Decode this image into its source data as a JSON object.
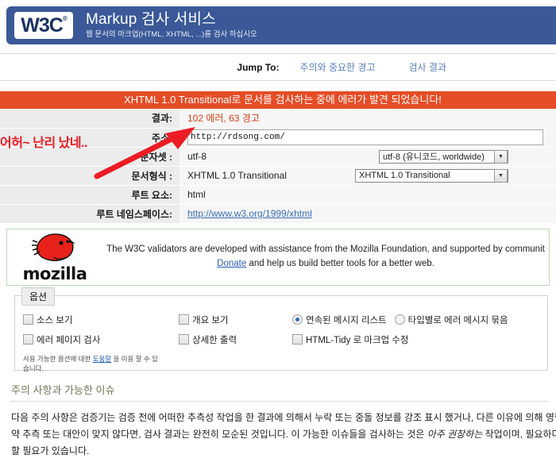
{
  "header": {
    "logo_text": "W3C",
    "logo_sup": "®",
    "title": "Markup 검사 서비스",
    "subtitle": "웹 문서의 마크업(HTML, XHTML, ...)를 검사 하십시오",
    "band_color": "#3b5998"
  },
  "jump": {
    "label": "Jump To:",
    "links": [
      {
        "label": "주의와 중요한 경고"
      },
      {
        "label": "검사 결과"
      }
    ]
  },
  "banner": {
    "text": "XHTML 1.0 Transitional로 문서를 검사하는 중에 에러가 발견 되었습니다!",
    "color": "#e44d26"
  },
  "info": {
    "rows": [
      {
        "label": "결과:",
        "value": "102 에러, 63 경고",
        "kind": "result"
      },
      {
        "label": "주소:",
        "value": "http://rdsong.com/",
        "kind": "input"
      },
      {
        "label": "문자셋 :",
        "value": "utf-8",
        "kind": "select",
        "select": "utf-8 (유니코드, worldwide)"
      },
      {
        "label": "문서형식 :",
        "value": "XHTML 1.0 Transitional",
        "kind": "select",
        "select": "XHTML 1.0 Transitional"
      },
      {
        "label": "루트 요소:",
        "value": "html",
        "kind": "text"
      },
      {
        "label": "루트 네임스페이스:",
        "value": "http://www.w3.org/1999/xhtml",
        "kind": "link"
      }
    ]
  },
  "mozilla": {
    "wordmark": "mozilla",
    "line1": "The W3C validators are developed with assistance from the Mozilla Foundation, and supported by communit",
    "donate": "Donate",
    "line2": " and help us build better tools for a better web.",
    "logo_color": "#e8221a"
  },
  "options": {
    "legend": "옵션",
    "checkboxes": [
      {
        "label": "소스 보기",
        "checked": false
      },
      {
        "label": "개요 보기",
        "checked": false
      },
      {
        "label": "에러 페이지 검사",
        "checked": false
      },
      {
        "label": "상세한 출력",
        "checked": false
      },
      {
        "label": "HTML-Tidy 로 마크업 수정",
        "checked": false
      }
    ],
    "radios": [
      {
        "label": "연속된 메시지 리스트",
        "selected": true
      },
      {
        "label": "타입별로 에러 메시지 묶음",
        "selected": false
      }
    ],
    "help_pre": "사용 가능한 옵션에 대한 ",
    "help_link": "도움말",
    "help_post": " 을 이용 할 수 있습니다."
  },
  "notes": {
    "heading": "주의 사항과 가능한 이슈",
    "line1": "다음 주의 사항은 검증기는 검증 전에 어떠한 추측성 작업을 한 결과에 의해서 누락 또는 중돌 정보를 강조 표시 했거나, 다른 이유에 의해 영향",
    "line2_a": "약 추측 또는 대안이 맞지 않다면, 검사 결과는 완전히 모순된 것입니다. 이 가능한 이슈들을 검사하는 것은 ",
    "line2_em": "아주 권장하는",
    "line2_b": " 작업이며, 필요하다",
    "line3": "할 필요가 있습니다."
  },
  "annotation": {
    "text": "어허~ 난리 났네..",
    "color": "#ec1c24"
  }
}
